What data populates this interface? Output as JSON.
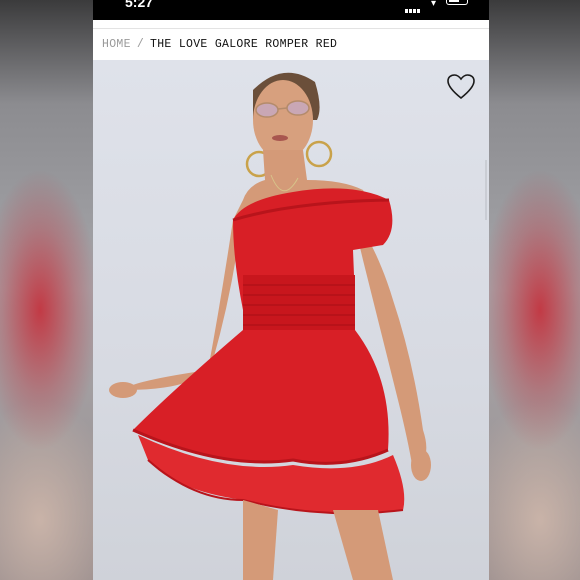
{
  "status_bar": {
    "time": "5:27"
  },
  "breadcrumb": {
    "home": "HOME",
    "separator": "/",
    "current": "THE LOVE GALORE ROMPER RED"
  },
  "product": {
    "image_icon": "product-photo",
    "wishlist_icon": "heart-outline-icon",
    "dress_color": "#d81f26"
  }
}
